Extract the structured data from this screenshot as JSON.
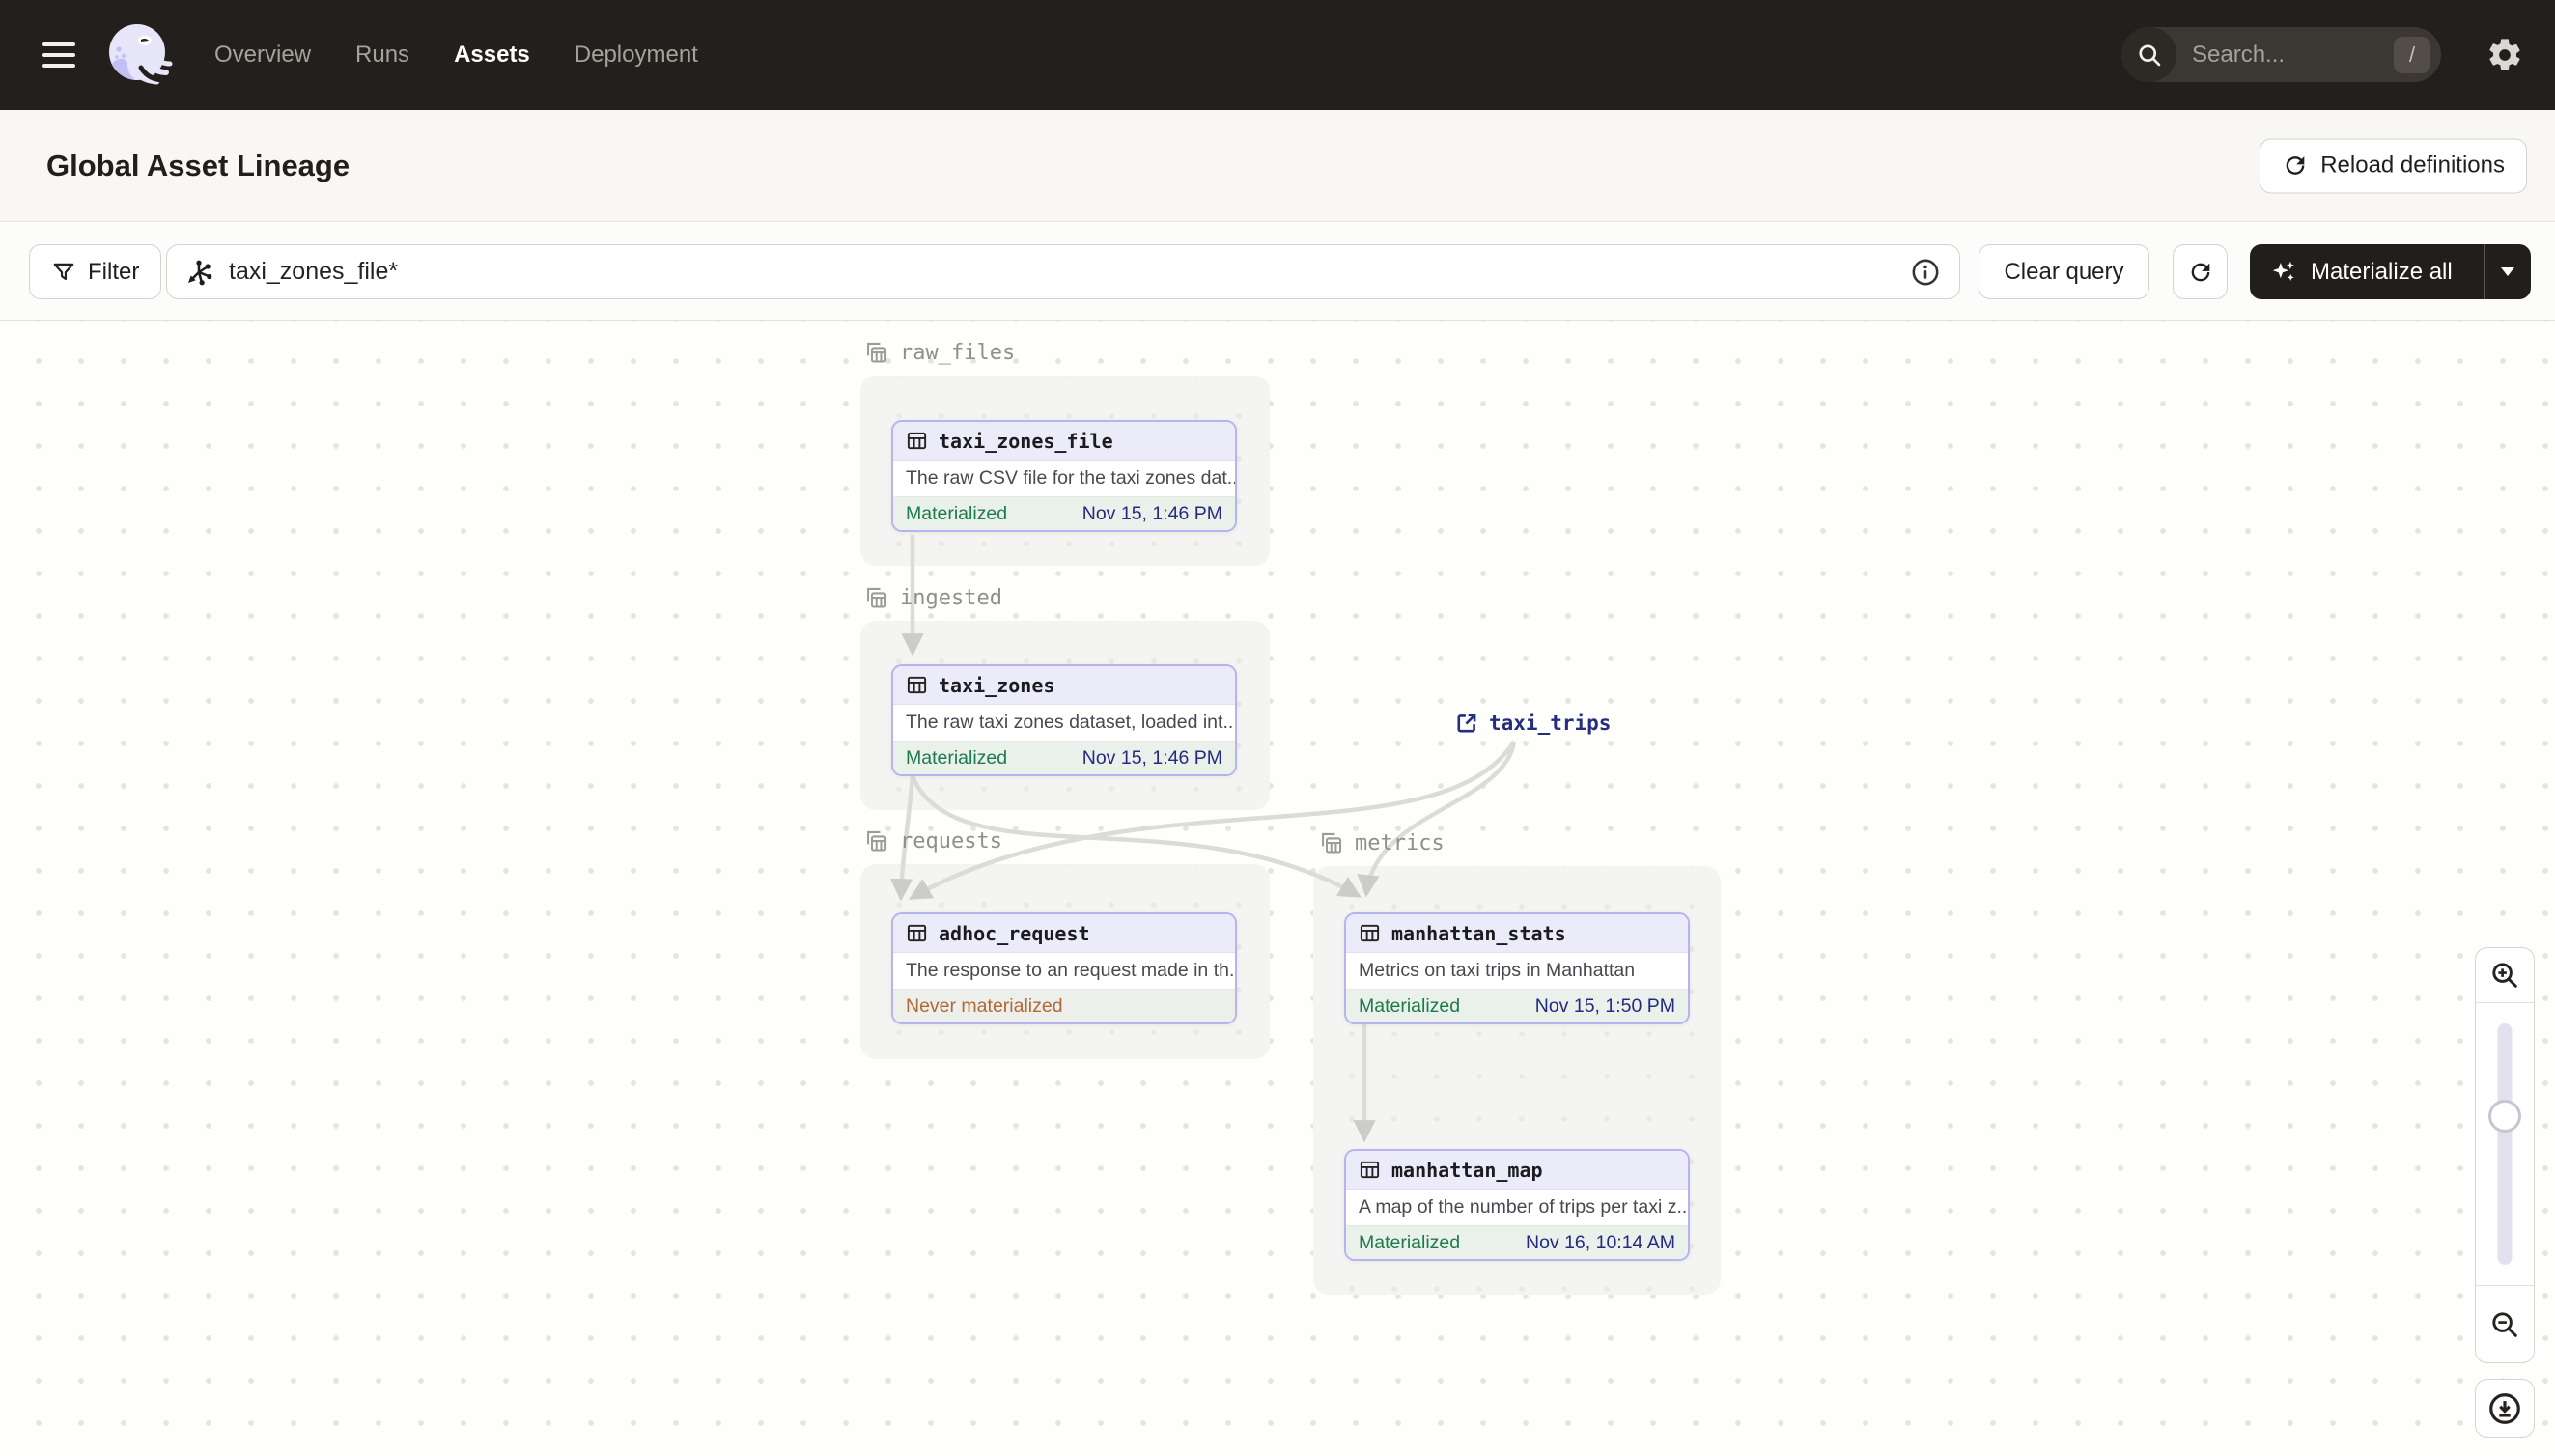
{
  "topnav": {
    "menu": [
      "Overview",
      "Runs",
      "Assets",
      "Deployment"
    ],
    "active": "Assets",
    "search_placeholder": "Search...",
    "search_shortcut": "/"
  },
  "header": {
    "title": "Global Asset Lineage",
    "reload_button": "Reload definitions"
  },
  "toolbar": {
    "filter_label": "Filter",
    "query_value": "taxi_zones_file*",
    "clear_label": "Clear query",
    "materialize_label": "Materialize all"
  },
  "graph": {
    "groups": [
      {
        "label": "raw_files"
      },
      {
        "label": "ingested"
      },
      {
        "label": "requests"
      },
      {
        "label": "metrics"
      }
    ],
    "nodes": [
      {
        "name": "taxi_zones_file",
        "description": "The raw CSV file for the taxi zones dat...",
        "status": "Materialized",
        "timestamp": "Nov 15, 1:46 PM"
      },
      {
        "name": "taxi_zones",
        "description": "The raw taxi zones dataset, loaded int...",
        "status": "Materialized",
        "timestamp": "Nov 15, 1:46 PM"
      },
      {
        "name": "adhoc_request",
        "description": "The response to an request made in th...",
        "status": "Never materialized",
        "timestamp": ""
      },
      {
        "name": "manhattan_stats",
        "description": "Metrics on taxi trips in Manhattan",
        "status": "Materialized",
        "timestamp": "Nov 15, 1:50 PM"
      },
      {
        "name": "manhattan_map",
        "description": "A map of the number of trips per taxi z...",
        "status": "Materialized",
        "timestamp": "Nov 16, 10:14 AM"
      }
    ],
    "external_assets": [
      {
        "name": "taxi_trips"
      }
    ]
  },
  "colors": {
    "topbar_bg": "#221F1C",
    "node_border": "#B7B3EF",
    "node_header_bg": "#ECEBFA",
    "materialized_green": "#1C7A4B",
    "never_materialized_orange": "#B26737",
    "timestamp_navy": "#232A80",
    "external_navy": "#252D7E",
    "edge_gray": "#DCDBD8"
  }
}
